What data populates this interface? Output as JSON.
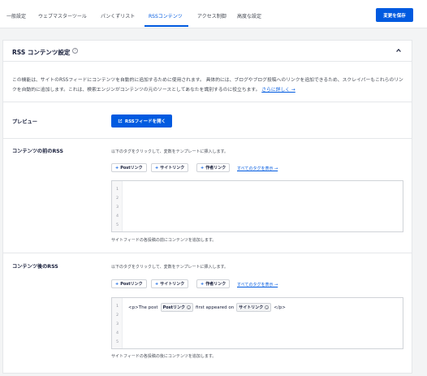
{
  "tabs": [
    {
      "label": "一般設定"
    },
    {
      "label": "ウェブマスターツール"
    },
    {
      "label": "パンくずリスト"
    },
    {
      "label": "RSSコンテンツ"
    },
    {
      "label": "アクセス制御"
    },
    {
      "label": "高度な設定"
    }
  ],
  "active_tab": 3,
  "save_label": "変更を保存",
  "card": {
    "title": "RSS コンテンツ設定",
    "description": "この機能は、サイトのRSSフィードにコンテンツを自動的に追加するために使用されます。 具体的には、ブログやブログ投稿へのリンクを追加できるため、スクレイパーもこれらのリンクを自動的に追加します。これは、検索エンジンがコンテンツの元のソースとしてあなたを識別するのに役立ちます。",
    "learn_more": "さらに詳しく →"
  },
  "preview": {
    "label": "プレビュー",
    "button": "RSSフィードを開く"
  },
  "before": {
    "label": "コンテンツの前のRSS",
    "hint": "以下のタグをクリックして、変数をテンプレートに挿入します。",
    "tags": [
      "Postリンク",
      "サイトリンク",
      "作者リンク"
    ],
    "view_all": "すべてのタグを表示 →",
    "line_numbers": [
      "1",
      "2",
      "3",
      "4",
      "5"
    ],
    "help": "サイトフィードの各投稿の前にコンテンツを追加します。"
  },
  "after": {
    "label": "コンテンツ後のRSS",
    "hint": "以下のタグをクリックして、変数をテンプレートに挿入します。",
    "tags": [
      "Postリンク",
      "サイトリンク",
      "作者リンク"
    ],
    "view_all": "すべてのタグを表示 →",
    "line_numbers": [
      "1",
      "2",
      "3",
      "4",
      "5"
    ],
    "code": {
      "prefix": "<p>The post",
      "chip1": "Postリンク",
      "middle": "first appeared on",
      "chip2": "サイトリンク",
      "suffix": "</p>"
    },
    "help": "サイトフィードの各投稿の後にコンテンツを追加します。"
  },
  "colors": {
    "accent": "#005ae0",
    "text": "#141b38",
    "muted": "#454a54"
  },
  "icons": {
    "help": "help-circle-icon",
    "collapse": "chevron-up-icon",
    "external": "external-link-icon",
    "plus": "plus-icon",
    "chevron": "chevron-down-icon"
  }
}
